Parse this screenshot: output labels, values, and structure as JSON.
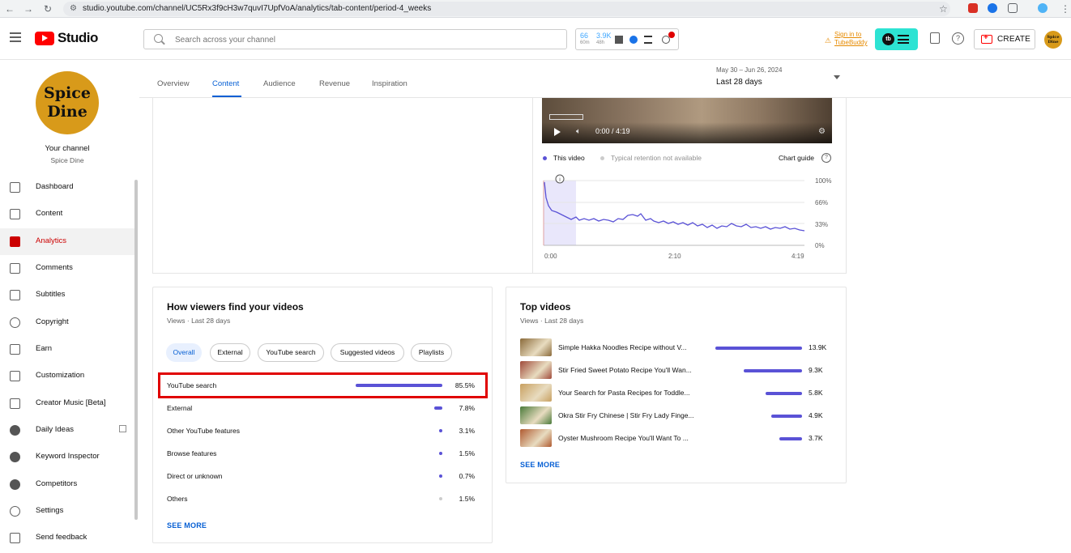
{
  "browser": {
    "url": "studio.youtube.com/channel/UC5Rx3f9cH3w7quvI7UpfVoA/analytics/tab-content/period-4_weeks"
  },
  "header": {
    "logo_text": "Studio",
    "search_placeholder": "Search across your channel",
    "tb_stats": [
      {
        "value": "66",
        "sub": "60m"
      },
      {
        "value": "3.9K",
        "sub": "48h"
      }
    ],
    "signin_line1": "Sign in to",
    "signin_line2": "TubeBuddy",
    "create_label": "CREATE",
    "avatar_text": "Spice Dine"
  },
  "sidebar": {
    "avatar_line1": "Spice",
    "avatar_line2": "Dine",
    "your_channel": "Your channel",
    "channel_name": "Spice Dine",
    "items": [
      {
        "label": "Dashboard",
        "icon": "dashboard-icon"
      },
      {
        "label": "Content",
        "icon": "content-icon"
      },
      {
        "label": "Analytics",
        "icon": "analytics-icon",
        "active": true
      },
      {
        "label": "Comments",
        "icon": "comments-icon"
      },
      {
        "label": "Subtitles",
        "icon": "subtitles-icon"
      },
      {
        "label": "Copyright",
        "icon": "copyright-icon"
      },
      {
        "label": "Earn",
        "icon": "earn-icon"
      },
      {
        "label": "Customization",
        "icon": "customization-icon"
      },
      {
        "label": "Creator Music [Beta]",
        "icon": "music-icon"
      },
      {
        "label": "Daily Ideas",
        "icon": "tubebuddy-icon"
      },
      {
        "label": "Keyword Inspector",
        "icon": "tubebuddy-icon"
      },
      {
        "label": "Competitors",
        "icon": "tubebuddy-icon"
      },
      {
        "label": "Settings",
        "icon": "settings-icon"
      },
      {
        "label": "Send feedback",
        "icon": "feedback-icon"
      }
    ]
  },
  "tabs": [
    "Overview",
    "Content",
    "Audience",
    "Revenue",
    "Inspiration"
  ],
  "active_tab": "Content",
  "date": {
    "range": "May 30 – Jun 26, 2024",
    "label": "Last 28 days"
  },
  "video": {
    "time": "0:00 / 4:19"
  },
  "retention": {
    "legend_this": "This video",
    "legend_typical": "Typical retention not available",
    "chart_guide": "Chart guide",
    "y_ticks": [
      "100%",
      "66%",
      "33%",
      "0%"
    ],
    "x_ticks": [
      "0:00",
      "2:10",
      "4:19"
    ],
    "accent": "#5a52d6"
  },
  "traffic": {
    "title": "How viewers find your videos",
    "subtitle": "Views · Last 28 days",
    "chips": [
      "Overall",
      "External",
      "YouTube search",
      "Suggested videos",
      "Playlists"
    ],
    "rows": [
      {
        "label": "YouTube search",
        "pct": "85.5%",
        "value": 85.5
      },
      {
        "label": "External",
        "pct": "7.8%",
        "value": 7.8
      },
      {
        "label": "Other YouTube features",
        "pct": "3.1%",
        "value": 3.1
      },
      {
        "label": "Browse features",
        "pct": "1.5%",
        "value": 1.5
      },
      {
        "label": "Direct or unknown",
        "pct": "0.7%",
        "value": 0.7
      },
      {
        "label": "Others",
        "pct": "1.5%",
        "value": 1.5
      }
    ],
    "see_more": "SEE MORE"
  },
  "top_videos": {
    "title": "Top videos",
    "subtitle": "Views · Last 28 days",
    "rows": [
      {
        "title": "Simple Hakka Noodles Recipe without V...",
        "views": "13.9K",
        "value": 13.9
      },
      {
        "title": "Stir Fried Sweet Potato Recipe You'll Wan...",
        "views": "9.3K",
        "value": 9.3
      },
      {
        "title": "Your Search for Pasta Recipes for Toddle...",
        "views": "5.8K",
        "value": 5.8
      },
      {
        "title": "Okra Stir Fry Chinese | Stir Fry Lady Finge...",
        "views": "4.9K",
        "value": 4.9
      },
      {
        "title": "Oyster Mushroom Recipe You'll Want To ...",
        "views": "3.7K",
        "value": 3.7
      }
    ],
    "see_more": "SEE MORE"
  }
}
